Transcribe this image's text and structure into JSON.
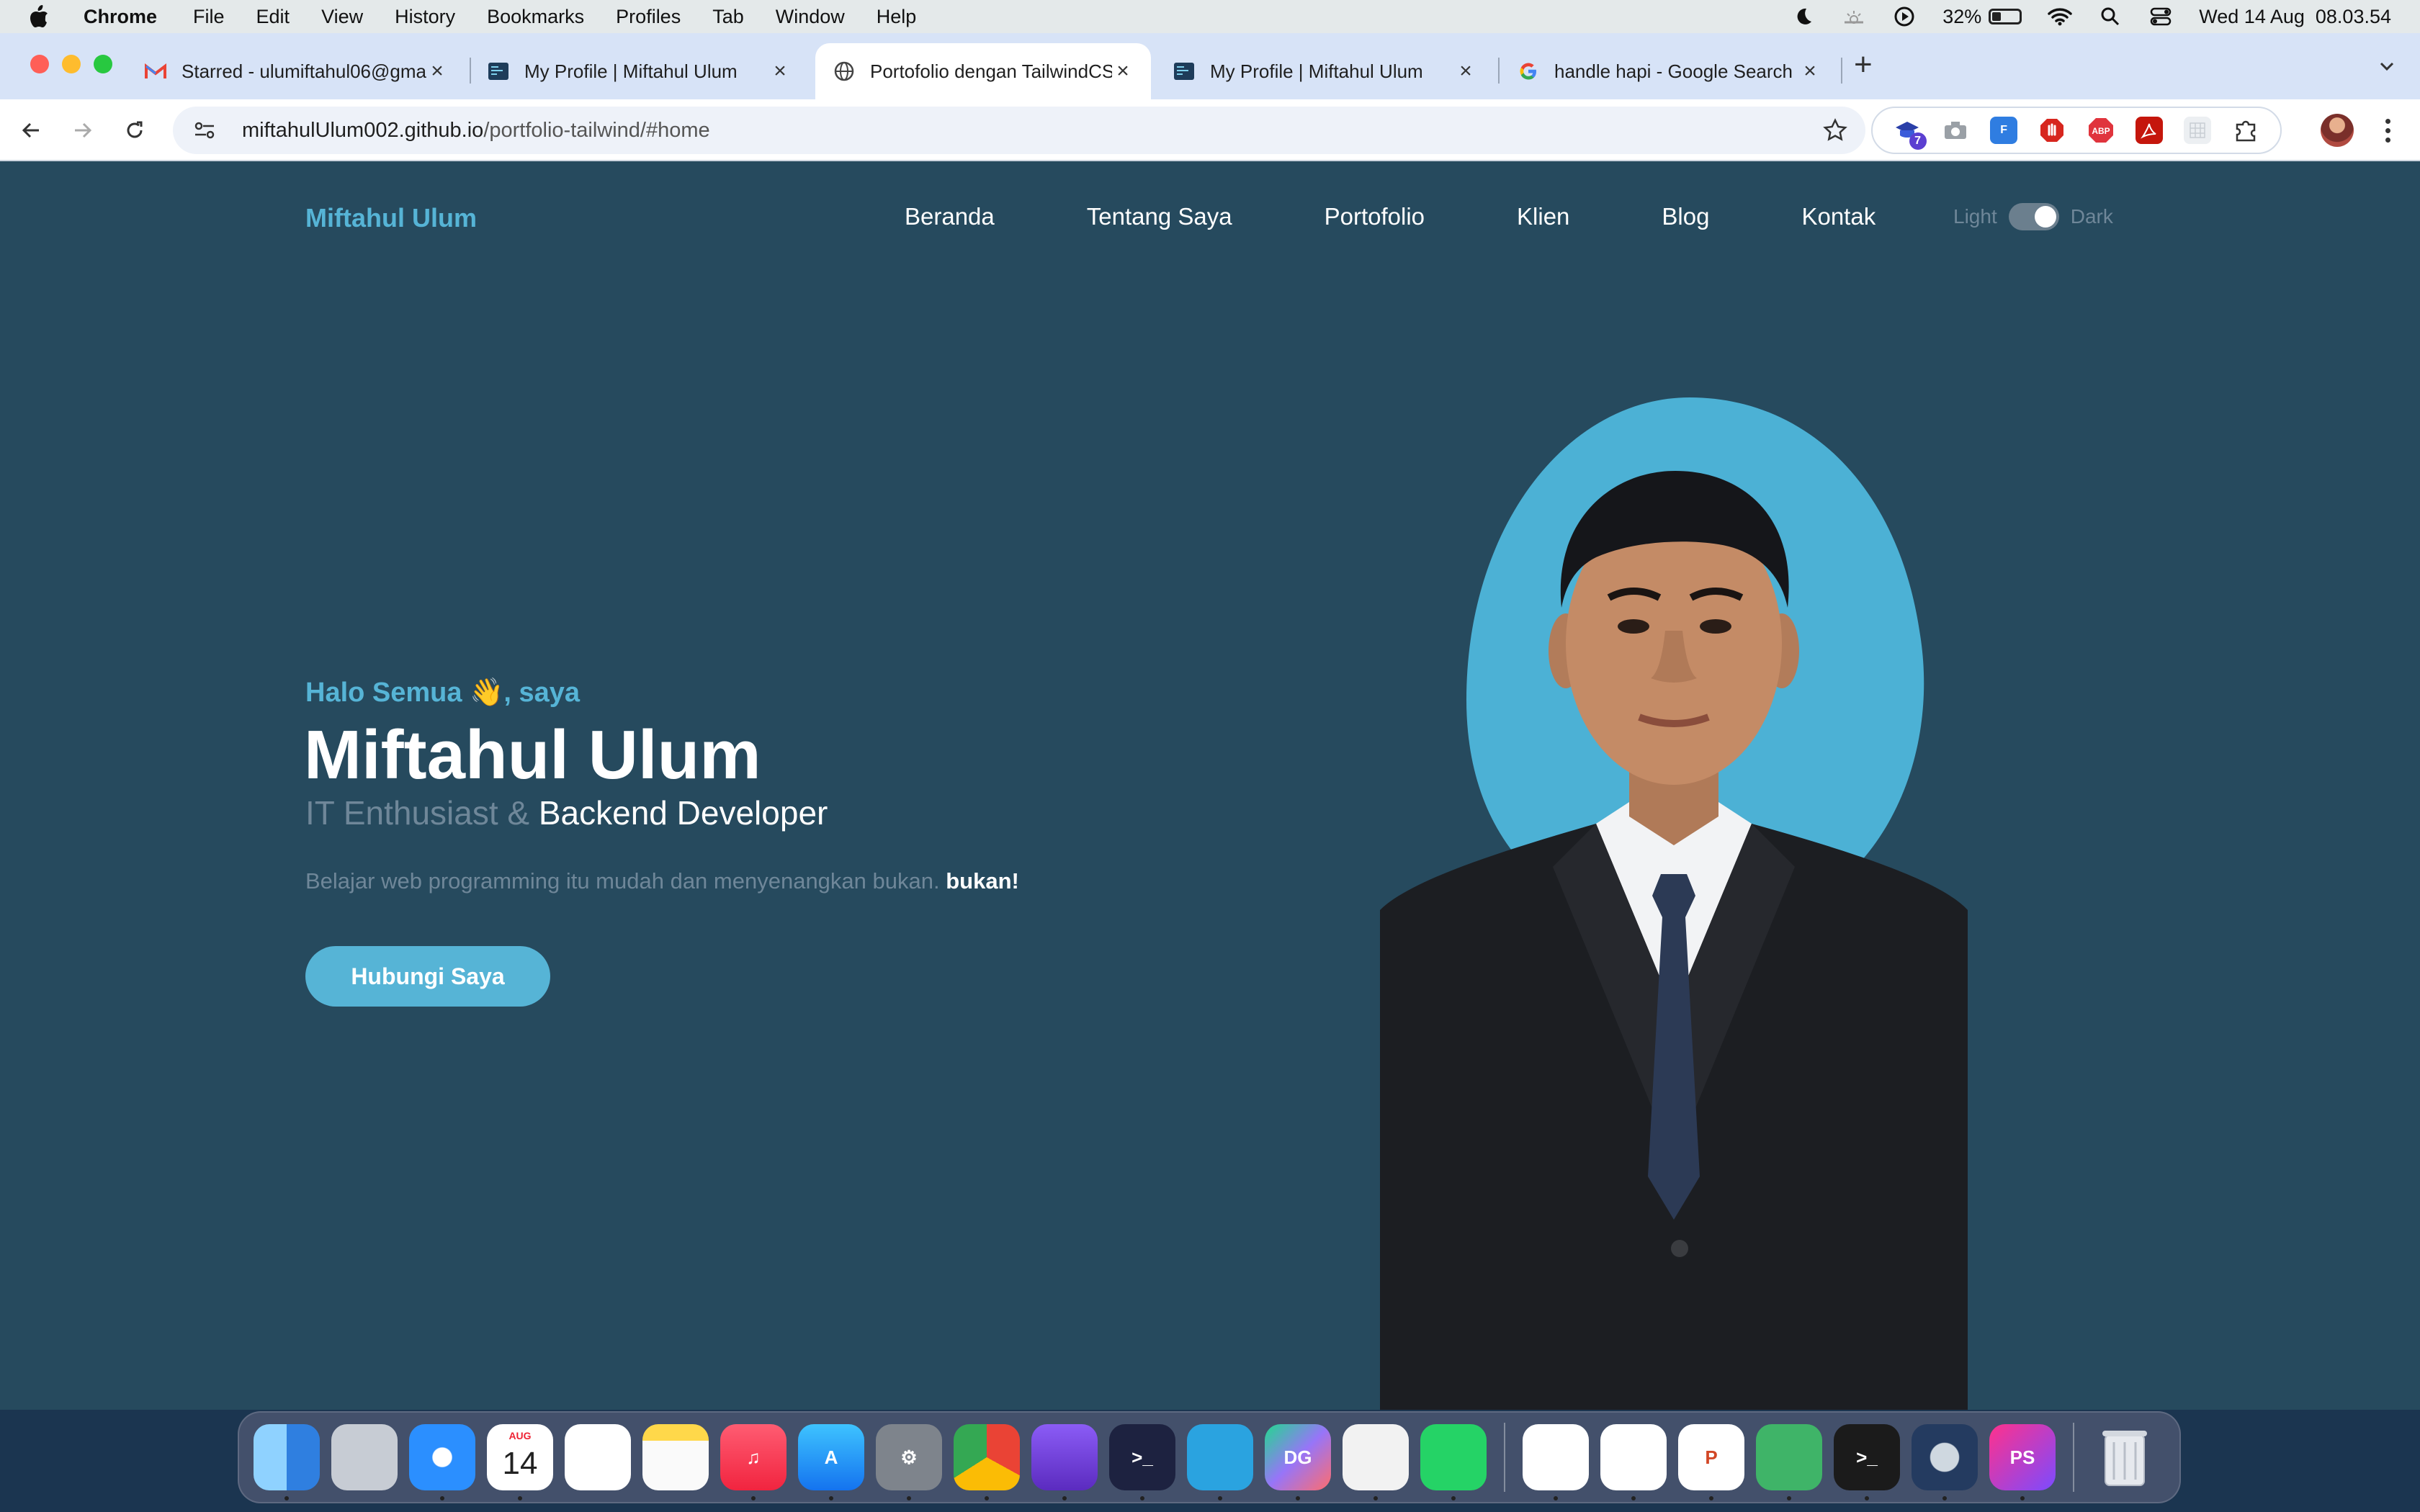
{
  "menubar": {
    "app_name": "Chrome",
    "items": [
      "File",
      "Edit",
      "View",
      "History",
      "Bookmarks",
      "Profiles",
      "Tab",
      "Window",
      "Help"
    ],
    "battery_percent": "32%",
    "battery_level": 0.32,
    "datetime": "Wed 14 Aug  08.03.54"
  },
  "tabs": [
    {
      "title": "Starred - ulumiftahul06@gma",
      "favicon": "gmail-icon",
      "active": false
    },
    {
      "title": "My Profile | Miftahul Ulum",
      "favicon": "code-page-icon",
      "active": false
    },
    {
      "title": "Portofolio dengan TailwindCS",
      "favicon": "globe-icon",
      "active": true
    },
    {
      "title": "My Profile | Miftahul Ulum",
      "favicon": "code-page-icon",
      "active": false
    },
    {
      "title": "handle hapi - Google Search",
      "favicon": "google-icon",
      "active": false
    }
  ],
  "toolbar": {
    "url_host": "miftahulUlum002.github.io",
    "url_path": "/portfolio-tailwind/#home"
  },
  "extensions": [
    {
      "name": "academic-cap-extension",
      "color": "#3b5bd9",
      "label": "",
      "badge": "7"
    },
    {
      "name": "camera-extension",
      "color": "#9aa0a6",
      "label": ""
    },
    {
      "name": "fl-extension",
      "color": "#2f7de1",
      "label": "F"
    },
    {
      "name": "stop-hand-extension",
      "color": "#d7261e",
      "label": ""
    },
    {
      "name": "adblock-plus-extension",
      "color": "#e0343d",
      "label": "ABP"
    },
    {
      "name": "pdf-extension",
      "color": "#c5160c",
      "label": ""
    },
    {
      "name": "grid-extension",
      "color": "#d5d9de",
      "label": ""
    },
    {
      "name": "puzzle-extensions-menu",
      "color": "#ffffff",
      "label": ""
    }
  ],
  "site": {
    "brand": "Miftahul Ulum",
    "nav": [
      "Beranda",
      "Tentang Saya",
      "Portofolio",
      "Klien",
      "Blog",
      "Kontak"
    ],
    "theme_light": "Light",
    "theme_dark": "Dark",
    "greeting": "Halo Semua 👋, saya",
    "name": "Miftahul Ulum",
    "role_prefix": "IT Enthusiast & ",
    "role_main": "Backend Developer",
    "desc_prefix": "Belajar web programming itu mudah dan menyenangkan bukan. ",
    "desc_strong": "bukan!",
    "cta": "Hubungi Saya"
  },
  "colors": {
    "accent": "#56b4d6",
    "page_bg": "#264a5e",
    "muted_text": "#6f8799"
  },
  "dock": {
    "calendar_month": "AUG",
    "calendar_day": "14",
    "apps": [
      {
        "name": "finder-icon",
        "label": ""
      },
      {
        "name": "launchpad-icon",
        "label": ""
      },
      {
        "name": "safari-icon",
        "label": ""
      },
      {
        "name": "calendar-icon",
        "label": ""
      },
      {
        "name": "reminders-icon",
        "label": ""
      },
      {
        "name": "notes-icon",
        "label": ""
      },
      {
        "name": "music-icon",
        "label": "♫"
      },
      {
        "name": "app-store-icon",
        "label": "A"
      },
      {
        "name": "system-settings-icon",
        "label": "⚙"
      },
      {
        "name": "chrome-icon",
        "label": ""
      },
      {
        "name": "database-icon",
        "label": ""
      },
      {
        "name": "cloud-terminal-icon",
        "label": ">_"
      },
      {
        "name": "telegram-icon",
        "label": ""
      },
      {
        "name": "datagrip-icon",
        "label": "DG"
      },
      {
        "name": "dog-app-icon",
        "label": ""
      },
      {
        "name": "whatsapp-icon",
        "label": ""
      },
      {
        "name": "vscode-icon",
        "label": ""
      },
      {
        "name": "capcut-icon",
        "label": ""
      },
      {
        "name": "powerpoint-icon",
        "label": "P"
      },
      {
        "name": "tableplus-icon",
        "label": ""
      },
      {
        "name": "terminal-icon",
        "label": ">_"
      },
      {
        "name": "quicktime-icon",
        "label": ""
      },
      {
        "name": "phpstorm-icon",
        "label": "PS"
      },
      {
        "name": "trash-icon",
        "label": ""
      }
    ]
  }
}
